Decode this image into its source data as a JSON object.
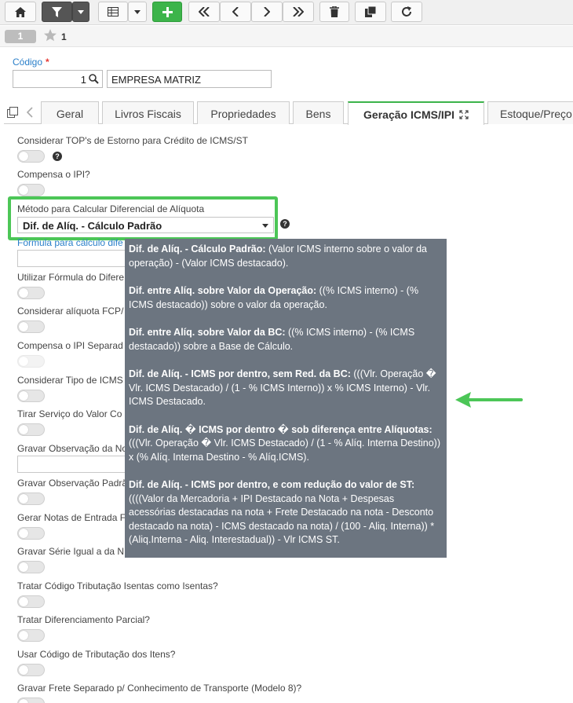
{
  "toolbar": {
    "buttons": [
      "home-icon",
      "filter-icon",
      "dropdown-icon",
      "grid-icon",
      "dropdown-icon",
      "add-icon",
      "first-icon",
      "prev-icon",
      "next-icon",
      "last-icon",
      "delete-icon",
      "copy-icon",
      "refresh-icon"
    ]
  },
  "record": {
    "index": "1",
    "favorites": "1"
  },
  "codigo": {
    "label": "Código",
    "required": "*",
    "value": "1",
    "empresa": "EMPRESA MATRIZ"
  },
  "tabs": [
    {
      "label": "Geral"
    },
    {
      "label": "Livros Fiscais"
    },
    {
      "label": "Propriedades"
    },
    {
      "label": "Bens"
    },
    {
      "label": "Geração ICMS/IPI"
    },
    {
      "label": "Estoque/Preço"
    }
  ],
  "fields": {
    "top_estorno": "Considerar TOP's de Estorno para Crédito de ICMS/ST",
    "compensa_ipi": "Compensa o IPI?",
    "metodo_label": "Método para Calcular Diferencial de Alíquota",
    "metodo_value": "Dif. de Alíq. - Cálculo Padrão",
    "formula_label": "Fórmula para cálculo dife",
    "utilizar_formula": "Utilizar Fórmula do Difere",
    "considerar_aliquota": "Considerar alíquota FCP/",
    "compensa_ipi_sep": "Compensa o IPI Separad",
    "considerar_tipo": "Considerar Tipo de ICMS",
    "tirar_servico": "Tirar Serviço do Valor Co",
    "gravar_obs_1": "Gravar Observação da No",
    "gravar_obs_2": "Gravar Observação Padrã",
    "gerar_notas": "Gerar Notas de Entrada F",
    "gravar_serie": "Gravar Série Igual a da N",
    "tratar_codigo": "Tratar Código Tributação Isentas como Isentas?",
    "tratar_dif": "Tratar Diferenciamento Parcial?",
    "usar_codigo": "Usar Código de Tributação dos Itens?",
    "gravar_frete": "Gravar Frete Separado p/ Conhecimento de Transporte (Modelo 8)?"
  },
  "help_glyph": "?",
  "tooltip": [
    {
      "title": "Dif. de Alíq. - Cálculo Padrão:",
      "text": " (Valor ICMS interno sobre o valor da operação) - (Valor ICMS destacado)."
    },
    {
      "title": "Dif. entre Alíq. sobre Valor da Operação:",
      "text": " ((% ICMS interno) - (% ICMS destacado)) sobre o valor da operação."
    },
    {
      "title": "Dif. entre Alíq. sobre Valor da BC:",
      "text": " ((% ICMS interno) - (% ICMS destacado)) sobre a Base de Cálculo."
    },
    {
      "title": "Dif. de Alíq. - ICMS por dentro, sem Red. da BC:",
      "text": " (((Vlr. Operação � Vlr. ICMS Destacado) / (1 - % ICMS Interno)) x % ICMS Interno) - Vlr. ICMS Destacado."
    },
    {
      "title": "Dif. de Alíq. � ICMS por dentro � sob diferença entre Alíquotas:",
      "text": " (((Vlr. Operação � Vlr. ICMS Destacado) / (1 - % Alíq. Interna Destino)) x (% Alíq. Interna Destino - % Alíq.ICMS)."
    },
    {
      "title": "Dif. de Alíq. - ICMS por dentro, e com redução do valor de ST:",
      "text": " ((((Valor da Mercadoria + IPI Destacado na Nota + Despesas acessórias destacadas na nota + Frete Destacado na nota - Desconto destacado na nota) - ICMS destacado na nota) / (100 - Aliq. Interna)) * (Aliq.Interna - Aliq. Interestadual)) - Vlr ICMS ST."
    }
  ],
  "colors": {
    "accent": "#3cb44a",
    "highlight": "#4cc657",
    "tooltip_bg": "#6c7580",
    "link": "#2a7fc9"
  }
}
